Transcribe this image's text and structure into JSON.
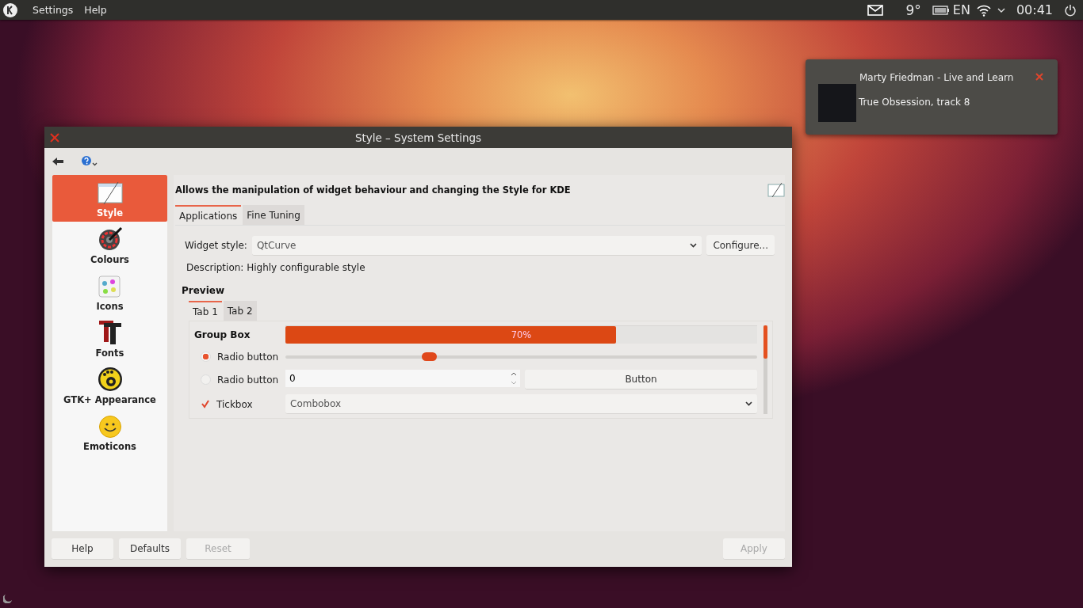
{
  "panel": {
    "menu": [
      "Settings",
      "Help"
    ],
    "temperature": "9°",
    "keyboard_layout": "EN",
    "clock": "00:41"
  },
  "notification": {
    "title": "Marty Friedman - Live and Learn",
    "body": "True Obsession, track 8"
  },
  "window": {
    "title": "Style – System Settings"
  },
  "sidebar": {
    "items": [
      {
        "label": "Style",
        "selected": true
      },
      {
        "label": "Colours",
        "selected": false
      },
      {
        "label": "Icons",
        "selected": false
      },
      {
        "label": "Fonts",
        "selected": false
      },
      {
        "label": "GTK+ Appearance",
        "selected": false
      },
      {
        "label": "Emoticons",
        "selected": false
      }
    ]
  },
  "header": "Allows the manipulation of widget behaviour and changing the Style for KDE",
  "tabs": [
    {
      "label": "Applications",
      "selected": true
    },
    {
      "label": "Fine Tuning",
      "selected": false
    }
  ],
  "widget_style": {
    "label": "Widget style:",
    "value": "QtCurve"
  },
  "configure_button": "Configure...",
  "description": "Description: Highly configurable style",
  "preview": {
    "title": "Preview",
    "tabs": [
      {
        "label": "Tab 1",
        "selected": true
      },
      {
        "label": "Tab 2",
        "selected": false
      }
    ],
    "group_box": "Group Box",
    "progress": {
      "level": 0.7,
      "reading": "70%"
    },
    "radios": [
      {
        "label": "Radio button",
        "selected": true
      },
      {
        "label": "Radio button",
        "selected": false
      }
    ],
    "slider": {
      "level": 0.31
    },
    "spin_value": "0",
    "button": "Button",
    "tickbox": {
      "label": "Tickbox",
      "checked": true
    },
    "combobox": "Combobox"
  },
  "buttons": [
    {
      "label": "Help",
      "disabled": false
    },
    {
      "label": "Defaults",
      "disabled": false
    },
    {
      "label": "Reset",
      "disabled": true
    },
    {
      "label": "Apply",
      "disabled": true
    }
  ]
}
